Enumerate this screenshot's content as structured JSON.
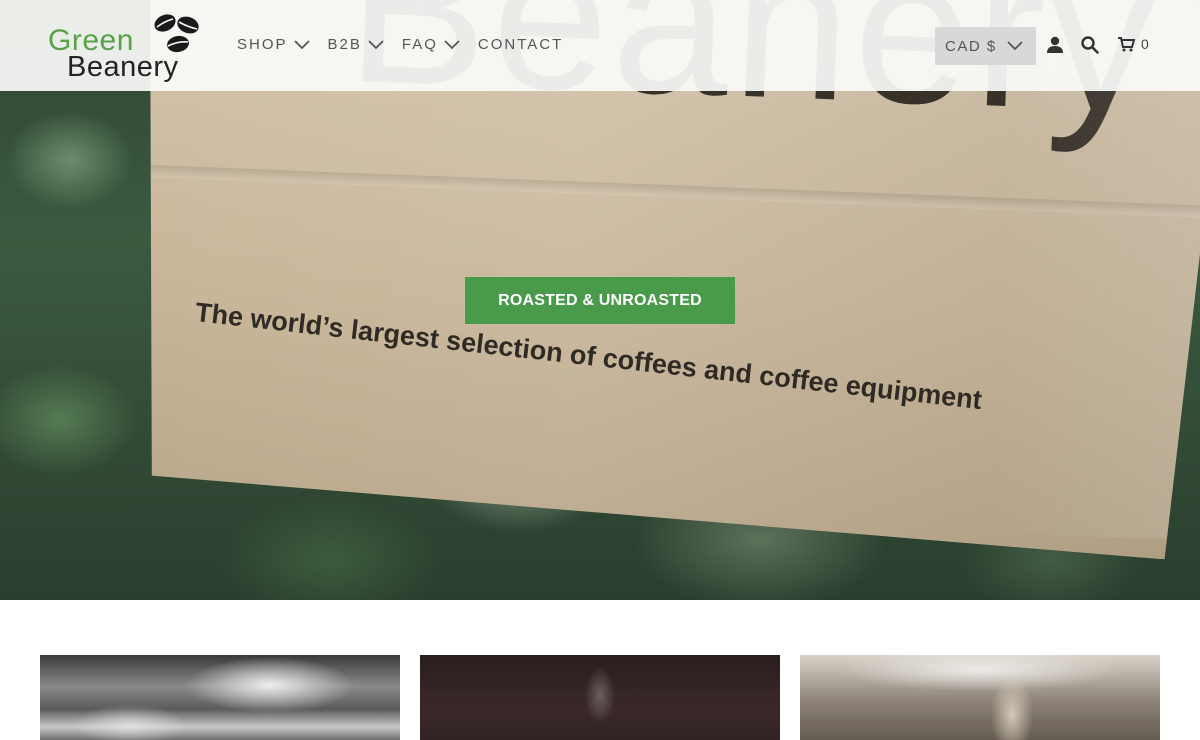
{
  "logo": {
    "line1": "Green",
    "line2": "Beanery"
  },
  "nav": {
    "items": [
      {
        "label": "SHOP",
        "has_dropdown": true
      },
      {
        "label": "B2B",
        "has_dropdown": true
      },
      {
        "label": "FAQ",
        "has_dropdown": true
      },
      {
        "label": "CONTACT",
        "has_dropdown": false
      }
    ]
  },
  "header_tools": {
    "currency": "CAD $",
    "account_icon": "user-icon",
    "search_icon": "search-icon",
    "cart_icon": "cart-icon",
    "cart_count": "0"
  },
  "hero": {
    "bag_brand_text": "Beanery",
    "bag_tagline": "The world’s largest selection of coffees and coffee equipment",
    "cta_label": "ROASTED & UNROASTED"
  },
  "colors": {
    "brand_green": "#5aa24a",
    "cta_green": "#4a9a4c",
    "nav_text": "#555555",
    "currency_bg": "#d8d8d8"
  }
}
